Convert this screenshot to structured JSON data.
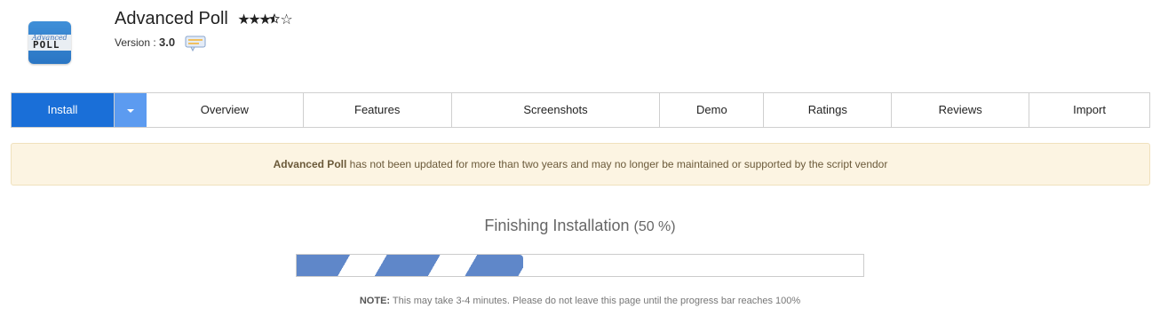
{
  "app": {
    "title": "Advanced Poll",
    "rating": 3.5,
    "rating_max": 5,
    "version_label": "Version :",
    "version_value": "3.0",
    "logo_text": "POLL",
    "logo_script": "Advanced"
  },
  "icons": {
    "changelog": "speech-bubble-icon",
    "caret": "caret-down-icon"
  },
  "tabs": [
    {
      "label": "Install",
      "active": true
    },
    {
      "label": "Overview"
    },
    {
      "label": "Features"
    },
    {
      "label": "Screenshots"
    },
    {
      "label": "Demo"
    },
    {
      "label": "Ratings"
    },
    {
      "label": "Reviews"
    },
    {
      "label": "Import"
    }
  ],
  "notice": {
    "app_name": "Advanced Poll",
    "message": " has not been updated for more than two years and may no longer be maintained or supported by the script vendor"
  },
  "progress": {
    "title": "Finishing Installation",
    "percent_label": "(50 %)",
    "value": 0.4,
    "note_label": "NOTE:",
    "note_text": " This may take 3-4 minutes. Please do not leave this page until the progress bar reaches 100%"
  },
  "colors": {
    "tab_active": "#1a6fd8",
    "tab_caret": "#5c9bf0",
    "notice_bg": "#fcf4e2",
    "progress_fill": "#5f87c9"
  }
}
